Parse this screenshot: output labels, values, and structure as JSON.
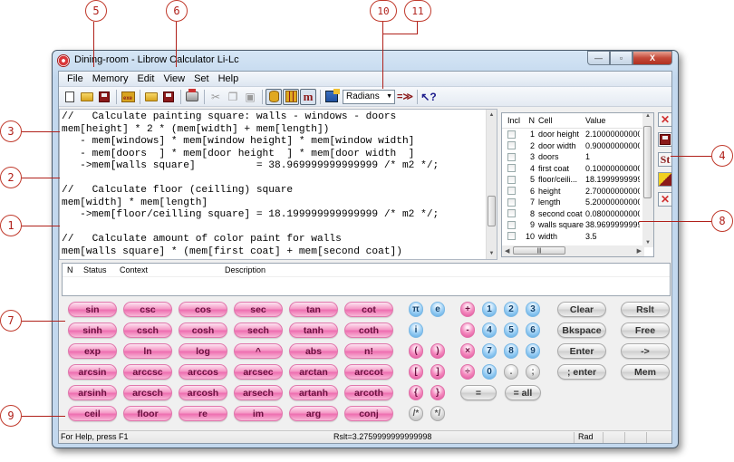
{
  "callouts": [
    "1",
    "2",
    "3",
    "4",
    "5",
    "6",
    "7",
    "8",
    "9",
    "10",
    "11"
  ],
  "window": {
    "title": "Dining-room - Librow Calculator Li-Lc",
    "controls": {
      "minimize": "—",
      "maximize": "▫",
      "close": "X"
    }
  },
  "menu": [
    {
      "label": "File",
      "accel": "F"
    },
    {
      "label": "Memory",
      "accel": "M"
    },
    {
      "label": "Edit",
      "accel": "E"
    },
    {
      "label": "View",
      "accel": "V"
    },
    {
      "label": "Set",
      "accel": "S"
    },
    {
      "label": "Help",
      "accel": "H"
    }
  ],
  "toolbar": {
    "angle_mode": "Radians",
    "icons": [
      "new-file",
      "open-folder",
      "save",
      "execute",
      "load-memory",
      "save-memory",
      "print",
      "cut",
      "copy",
      "paste",
      "memory-panel",
      "grid-view",
      "memory-m",
      "calculator",
      "angle-mode-select",
      "evaluate-all",
      "context-help"
    ]
  },
  "editor": {
    "lines": [
      "//   Calculate painting square: walls - windows - doors",
      "mem[height] * 2 * (mem[width] + mem[length])",
      "   - mem[windows] * mem[window height] * mem[window width]",
      "   - mem[doors  ] * mem[door height  ] * mem[door width  ]",
      "   ->mem[walls square]          = 38.969999999999999 /* m2 */;",
      "",
      "//   Calculate floor (ceilling) square",
      "mem[width] * mem[length]",
      "   ->mem[floor/ceilling square] = 18.199999999999999 /* m2 */;",
      "",
      "//   Calculate amount of color paint for walls",
      "mem[walls square] * (mem[first coat] + mem[second coat])"
    ]
  },
  "memory": {
    "columns": [
      "Incl",
      "N",
      "Cell",
      "Value"
    ],
    "rows": [
      {
        "n": "1",
        "cell": "door height",
        "value": "2.100000000000"
      },
      {
        "n": "2",
        "cell": "door width",
        "value": "0.900000000000"
      },
      {
        "n": "3",
        "cell": "doors",
        "value": "1"
      },
      {
        "n": "4",
        "cell": "first coat",
        "value": "0.100000000000"
      },
      {
        "n": "5",
        "cell": "floor/ceili...",
        "value": "18.19999999999"
      },
      {
        "n": "6",
        "cell": "height",
        "value": "2.700000000000"
      },
      {
        "n": "7",
        "cell": "length",
        "value": "5.200000000000"
      },
      {
        "n": "8",
        "cell": "second coat",
        "value": "0.080000000000"
      },
      {
        "n": "9",
        "cell": "walls square",
        "value": "38.96999999999"
      },
      {
        "n": "10",
        "cell": "width",
        "value": "3.5"
      }
    ],
    "tools": [
      "delete-cell",
      "save-memory",
      "store",
      "rename-cell",
      "clear-memory"
    ],
    "tool_labels": {
      "delete": "✕",
      "store": "St",
      "clear": "✕"
    }
  },
  "errors": {
    "columns": [
      "N",
      "Status",
      "Context",
      "Description"
    ]
  },
  "keypad": {
    "functions": [
      [
        "sin",
        "csc",
        "cos",
        "sec",
        "tan",
        "cot"
      ],
      [
        "sinh",
        "csch",
        "cosh",
        "sech",
        "tanh",
        "coth"
      ],
      [
        "exp",
        "ln",
        "log",
        "^",
        "abs",
        "n!"
      ],
      [
        "arcsin",
        "arccsc",
        "arccos",
        "arcsec",
        "arctan",
        "arccot"
      ],
      [
        "arsinh",
        "arcsch",
        "arcosh",
        "arsech",
        "artanh",
        "arcoth"
      ],
      [
        "ceil",
        "floor",
        "re",
        "im",
        "arg",
        "conj"
      ]
    ],
    "constants": [
      "π",
      "e",
      "i"
    ],
    "brackets": [
      "(",
      ")",
      "[",
      "]",
      "{",
      "}"
    ],
    "comments": [
      "/*",
      "*/"
    ],
    "operators": [
      "+",
      "-",
      "×",
      "÷"
    ],
    "digits": [
      "1",
      "2",
      "3",
      "4",
      "5",
      "6",
      "7",
      "8",
      "9",
      "0",
      ".",
      ";"
    ],
    "eval": [
      "=",
      "= all"
    ],
    "commands": [
      [
        "Clear",
        "Rslt"
      ],
      [
        "Bkspace",
        "Free"
      ],
      [
        "Enter",
        "->"
      ],
      [
        "; enter",
        "Mem"
      ]
    ]
  },
  "status": {
    "help": "For Help, press F1",
    "result": "Rslt=3.2759999999999998",
    "mode": "Rad"
  }
}
